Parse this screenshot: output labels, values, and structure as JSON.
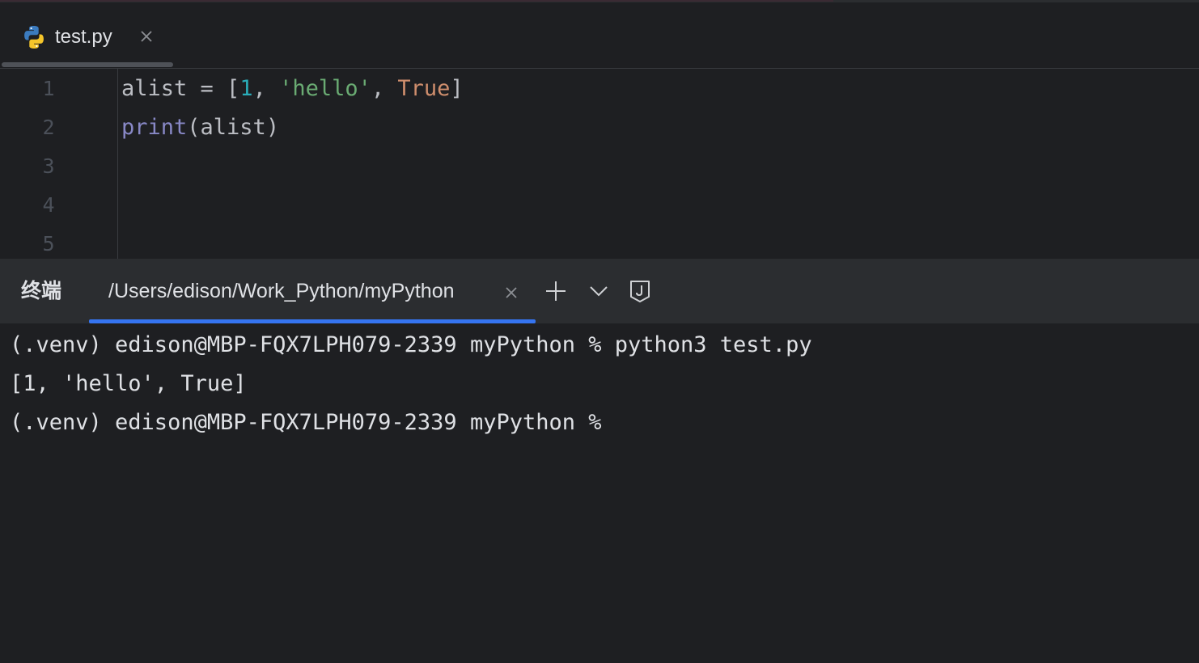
{
  "editor": {
    "tab": {
      "filename": "test.py",
      "icon": "python-file-icon"
    },
    "lines": [
      {
        "number": "1",
        "tokens": [
          {
            "text": "alist = [",
            "kind": "plain"
          },
          {
            "text": "1",
            "kind": "num"
          },
          {
            "text": ", ",
            "kind": "plain"
          },
          {
            "text": "'hello'",
            "kind": "str"
          },
          {
            "text": ", ",
            "kind": "plain"
          },
          {
            "text": "True",
            "kind": "kw"
          },
          {
            "text": "]",
            "kind": "plain"
          }
        ]
      },
      {
        "number": "2",
        "tokens": [
          {
            "text": "print",
            "kind": "builtin"
          },
          {
            "text": "(alist)",
            "kind": "plain"
          }
        ]
      },
      {
        "number": "3",
        "tokens": []
      },
      {
        "number": "4",
        "tokens": []
      },
      {
        "number": "5",
        "tokens": []
      }
    ]
  },
  "terminal": {
    "title": "终端",
    "tab_path": "/Users/edison/Work_Python/myPython",
    "lines": [
      "(.venv) edison@MBP-FQX7LPH079-2339 myPython % python3 test.py",
      "[1, 'hello', True]",
      "(.venv) edison@MBP-FQX7LPH079-2339 myPython %"
    ]
  },
  "colors": {
    "background": "#1e1f22",
    "panel_header": "#2b2d30",
    "accent": "#3574f0",
    "number": "#2aacb8",
    "string": "#6aab73",
    "keyword": "#cf8e6d",
    "builtin": "#8888c6"
  }
}
